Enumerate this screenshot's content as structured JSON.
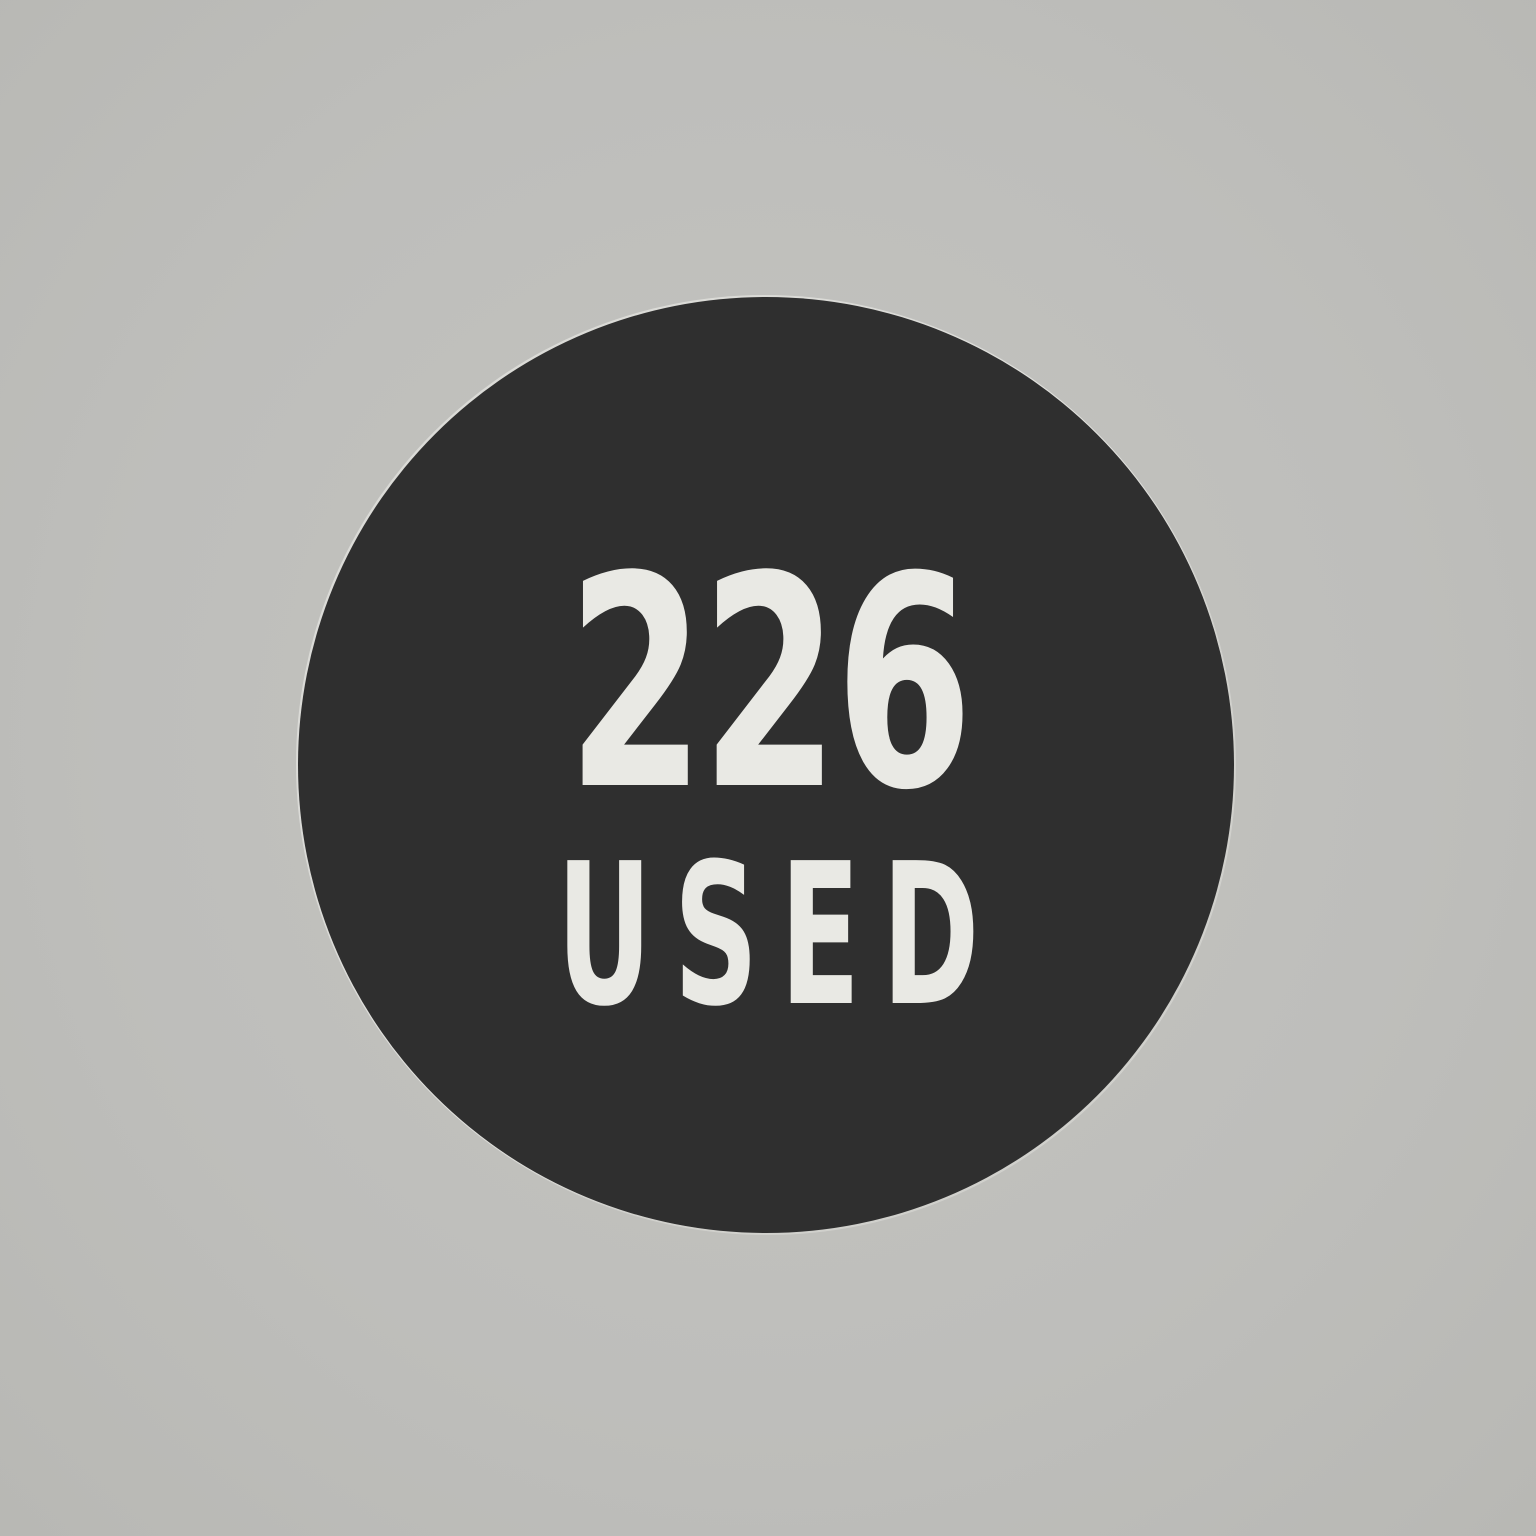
{
  "badge": {
    "count": "226",
    "label": "USED",
    "circle_color": "#2f2f2f",
    "text_color": "#e9e9e4",
    "background_color": "#c0c0bc"
  }
}
